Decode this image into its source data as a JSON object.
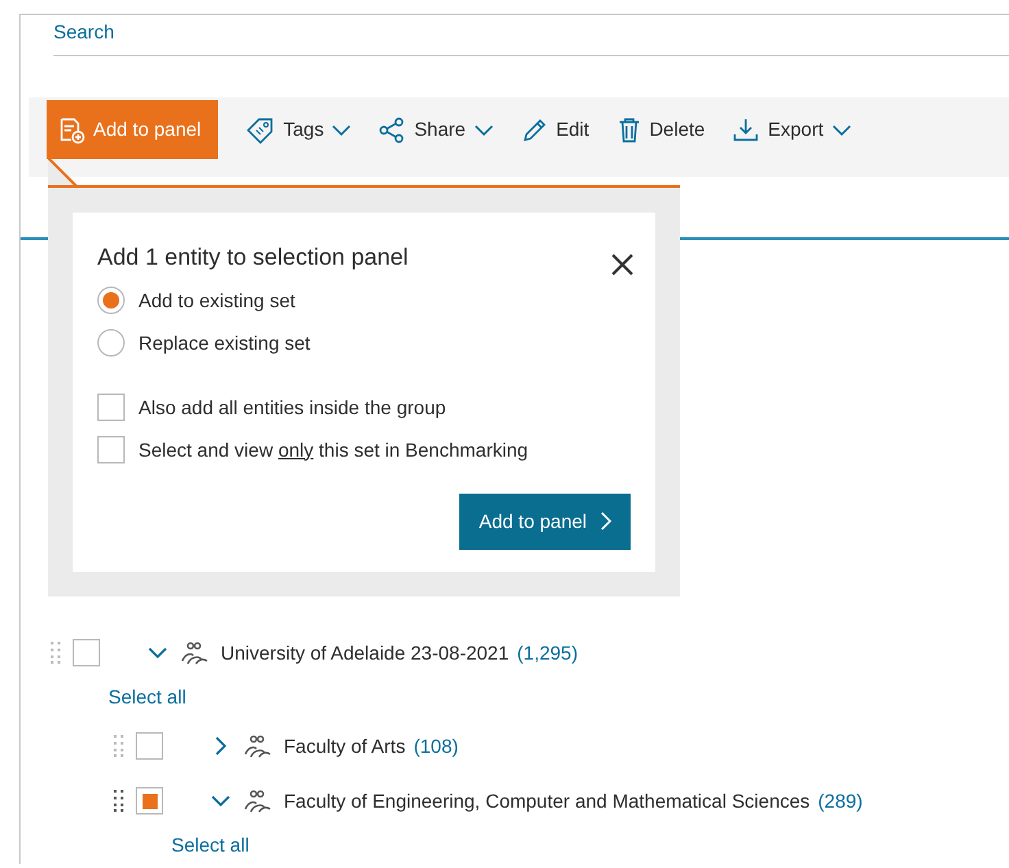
{
  "search": {
    "label": "Search"
  },
  "toolbar": [
    {
      "label": "Add to panel",
      "kind": "primary",
      "menu": false
    },
    {
      "label": "Tags",
      "kind": "plain",
      "menu": true
    },
    {
      "label": "Share",
      "kind": "plain",
      "menu": true
    },
    {
      "label": "Edit",
      "kind": "plain",
      "menu": false
    },
    {
      "label": "Delete",
      "kind": "plain",
      "menu": false
    },
    {
      "label": "Export",
      "kind": "plain",
      "menu": true
    }
  ],
  "popup": {
    "title": "Add 1 entity to selection panel",
    "options": [
      {
        "label": "Add to existing set",
        "selected": true
      },
      {
        "label": "Replace existing set",
        "selected": false
      }
    ],
    "checks": [
      {
        "label": "Also add all entities inside the group",
        "checked": false
      },
      {
        "label": "Select and view ",
        "emphasis": "only",
        "label_after": " this set in Benchmarking",
        "checked": false
      }
    ],
    "button": "Add to panel"
  },
  "tree": [
    {
      "label": "University of Adelaide 23-08-2021",
      "count": "(1,295)",
      "expanded": true,
      "checked": false,
      "select_all": "Select all",
      "children": [
        {
          "label": "Faculty of Arts",
          "count": "(108)",
          "expanded": false,
          "checked": false
        },
        {
          "label": "Faculty of Engineering, Computer and Mathematical Sciences",
          "count": "(289)",
          "expanded": true,
          "checked": true,
          "select_all": "Select all"
        }
      ]
    }
  ]
}
